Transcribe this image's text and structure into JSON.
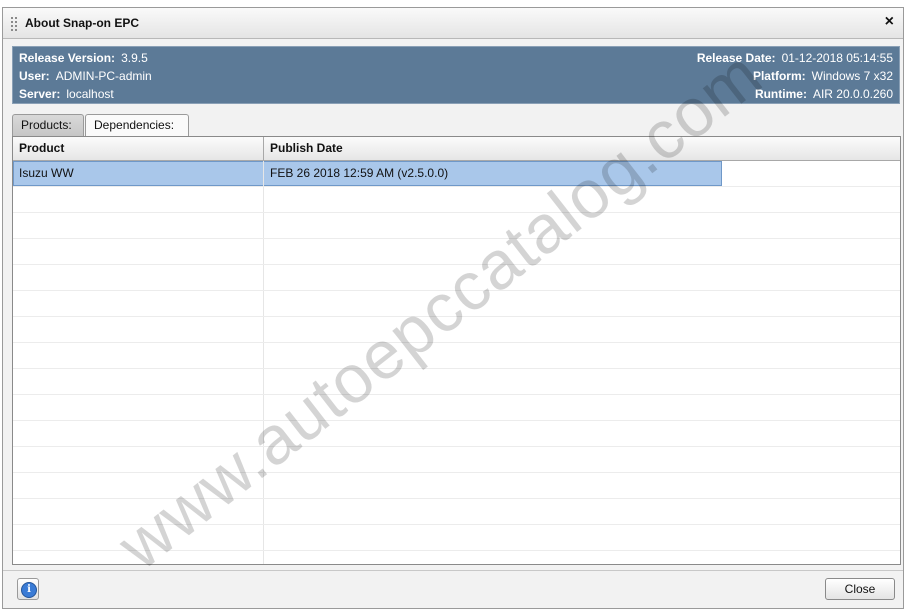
{
  "window": {
    "title": "About Snap-on EPC",
    "close_glyph": "×"
  },
  "info": {
    "left": [
      {
        "label": "Release Version:",
        "value": "3.9.5"
      },
      {
        "label": "User:",
        "value": "ADMIN-PC-admin"
      },
      {
        "label": "Server:",
        "value": "localhost"
      }
    ],
    "right": [
      {
        "label": "Release Date:",
        "value": "01-12-2018 05:14:55"
      },
      {
        "label": "Platform:",
        "value": "Windows 7 x32"
      },
      {
        "label": "Runtime:",
        "value": "AIR 20.0.0.260"
      }
    ],
    "panel_color": "#5c7a97"
  },
  "tabs": [
    {
      "label": "Products:",
      "active": true
    },
    {
      "label": "Dependencies:",
      "active": false
    }
  ],
  "table": {
    "columns": [
      "Product",
      "Publish Date"
    ],
    "rows": [
      {
        "product": "Isuzu WW",
        "publish_date": "FEB 26 2018 12:59 AM (v2.5.0.0)",
        "selected": true
      }
    ],
    "selection_color": "#a9c7ea"
  },
  "footer": {
    "info_icon": "info-icon",
    "close_label": "Close"
  },
  "watermark": "www.autoepccatalog.com"
}
